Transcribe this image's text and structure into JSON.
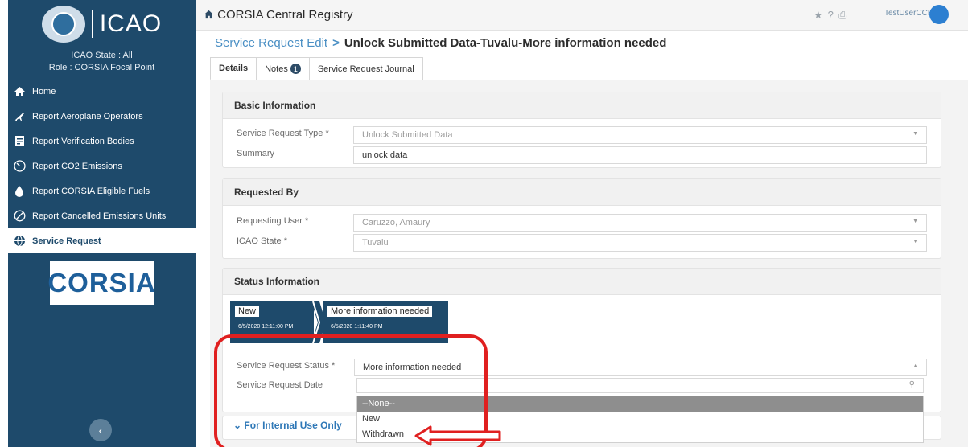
{
  "sidebar": {
    "logo_text": "ICAO",
    "role_lines": [
      "ICAO State : All",
      "Role : CORSIA Focal Point"
    ],
    "items": [
      {
        "label": "Home",
        "icon": "home-icon"
      },
      {
        "label": "Report Aeroplane Operators",
        "icon": "airplane-icon"
      },
      {
        "label": "Report Verification Bodies",
        "icon": "document-icon"
      },
      {
        "label": "Report CO2 Emissions",
        "icon": "co2-gauge-icon"
      },
      {
        "label": "Report CORSIA Eligible Fuels",
        "icon": "fuel-drop-icon"
      },
      {
        "label": "Report Cancelled Emissions Units",
        "icon": "cancel-icon"
      },
      {
        "label": "Service Request",
        "icon": "globe-icon",
        "active": true
      }
    ],
    "corsia_logo": "CORSIA"
  },
  "topbar": {
    "app_title": "CORSIA Central Registry",
    "icons": [
      "star-icon",
      "help-icon",
      "print-icon"
    ],
    "username": "TestUserCCR"
  },
  "header": {
    "breadcrumb_link": "Service Request Edit",
    "breadcrumb_separator": ">",
    "page_title": "Unlock Submitted Data-Tuvalu-More information needed"
  },
  "tabs": [
    {
      "label": "Details",
      "active": true
    },
    {
      "label": "Notes",
      "badge": "1"
    },
    {
      "label": "Service Request Journal"
    }
  ],
  "basic_info": {
    "title": "Basic Information",
    "type_label": "Service Request Type *",
    "type_value": "Unlock Submitted Data",
    "summary_label": "Summary",
    "summary_value": "unlock data"
  },
  "requested_by": {
    "title": "Requested By",
    "user_label": "Requesting User *",
    "user_value": "Caruzzo, Amaury",
    "state_label": "ICAO State *",
    "state_value": "Tuvalu"
  },
  "status_info": {
    "title": "Status Information",
    "stages": [
      {
        "name": "New",
        "date": "6/5/2020 12:11:00 PM"
      },
      {
        "name": "More information needed",
        "date": "6/5/2020 1:11:40 PM"
      }
    ],
    "status_label": "Service Request Status *",
    "status_value": "More information needed",
    "date_label": "Service Request Date",
    "date_value": "",
    "dropdown_options": [
      "--None--",
      "New",
      "Withdrawn"
    ]
  },
  "internal": {
    "label": "For Internal Use Only"
  },
  "colors": {
    "sidebar_bg": "#1e4a6b",
    "link": "#4a8fc4",
    "annotation": "#e02020"
  }
}
